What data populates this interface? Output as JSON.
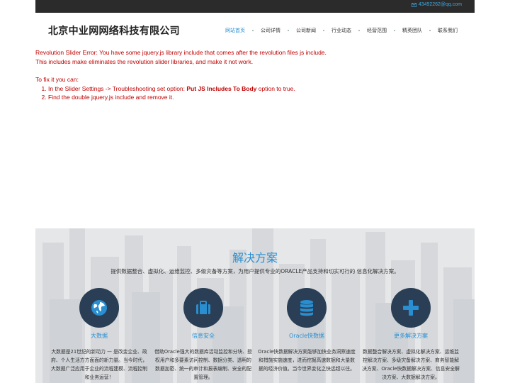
{
  "topbar": {
    "email": "43492262@qq.com"
  },
  "header": {
    "company_name": "北京中业网网络科技有限公司",
    "nav": [
      "网站首页",
      "公司详情",
      "公司新闻",
      "行业动态",
      "经营范围",
      "精英团队",
      "联系我们"
    ]
  },
  "error": {
    "line1": "Revolution Slider Error: You have some jquery.js library include that comes after the revolution files js include.",
    "line2": "This includes make eliminates the revolution slider libraries, and make it not work.",
    "fix_intro": "To fix it you can:",
    "step1_pre": "In the Slider Settings -> Troubleshooting set option: ",
    "step1_bold": "Put JS Includes To Body",
    "step1_post": " option to true.",
    "step2": "Find the double jquery.js include and remove it."
  },
  "solutions": {
    "title": "解决方案",
    "subtitle": "提供数据整合、虚拟化、运维监控、多级灾备等方案，为用户提供专业的ORACLE产品支持和切实可行的 信息化解决方案。",
    "features": [
      {
        "icon": "globe-icon",
        "title": "大数据",
        "desc": "大数据是21世纪的新动力 — 是改变企业、政府、个人生活方方面面的新力量。当今时代，大数据广泛应用于企业的流程建模、流程控制和业务运营！"
      },
      {
        "icon": "briefcase-icon",
        "title": "信息安全",
        "desc": "借助Oracle强大的数据库活动监控和分块、授权用户和多要素访问控制、数据分类、透明的数据加密、统一的审计和报表编制、安全的配置管理。"
      },
      {
        "icon": "database-icon",
        "title": "Oracle快数据",
        "desc": "Oracle快数据解决方案能够加快业务洞察速度和措施实施速度，进而挖掘高速数据和大量数据的经济价值。当今世界变化之快远超以往。"
      },
      {
        "icon": "plus-icon",
        "title": "更多解决方案",
        "desc": "数据整合解决方案、虚拟化解决方案、运维监控解决方案、多级灾备解决方案、商务智能解决方案、Oracle快数据解决方案、信息安全解决方案、大数据解决方案。"
      }
    ]
  },
  "colors": {
    "accent": "#2a8fd1",
    "icon_circle": "#2a3f55",
    "error_text": "#c00000",
    "topbar": "#2b2b2b"
  }
}
